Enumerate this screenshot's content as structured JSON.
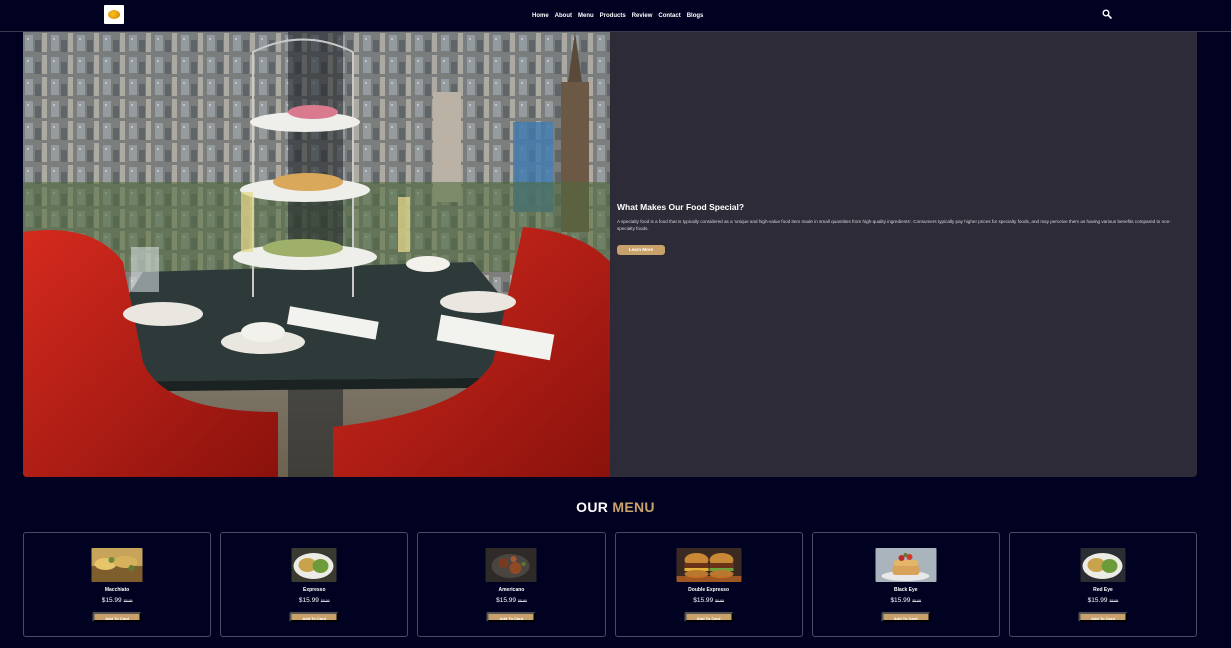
{
  "nav": {
    "items": [
      "Home",
      "About",
      "Menu",
      "Products",
      "Review",
      "Contact",
      "Blogs"
    ]
  },
  "hero": {
    "title": "What Makes Our Food Special?",
    "description": "A specialty food is a food that is typically considered as a 'unique and high-value food item made in small quantities from high-quality ingredients'. Consumers typically pay higher prices for specialty foods, and may perceive them as having various benefits compared to non-specialty foods.",
    "button_label": "Learn More"
  },
  "menu": {
    "title_white": "OUR",
    "title_accent": "MENU",
    "items": [
      {
        "name": "Macchiato",
        "price": "$15.99",
        "old_price": "$8.99",
        "button": "Add To Card"
      },
      {
        "name": "Expresso",
        "price": "$15.99",
        "old_price": "$8.99",
        "button": "Add To Card"
      },
      {
        "name": "Americano",
        "price": "$15.99",
        "old_price": "$8.99",
        "button": "Add To Card"
      },
      {
        "name": "Double Expresso",
        "price": "$15.99",
        "old_price": "$8.99",
        "button": "Add To Card"
      },
      {
        "name": "Black Eye",
        "price": "$15.99",
        "old_price": "$8.99",
        "button": "Add To Card"
      },
      {
        "name": "Red Eye",
        "price": "$15.99",
        "old_price": "$8.99",
        "button": "Add To Card"
      }
    ]
  },
  "colors": {
    "background": "#010221",
    "panel": "#2c2b37",
    "accent": "#c9a16a"
  }
}
